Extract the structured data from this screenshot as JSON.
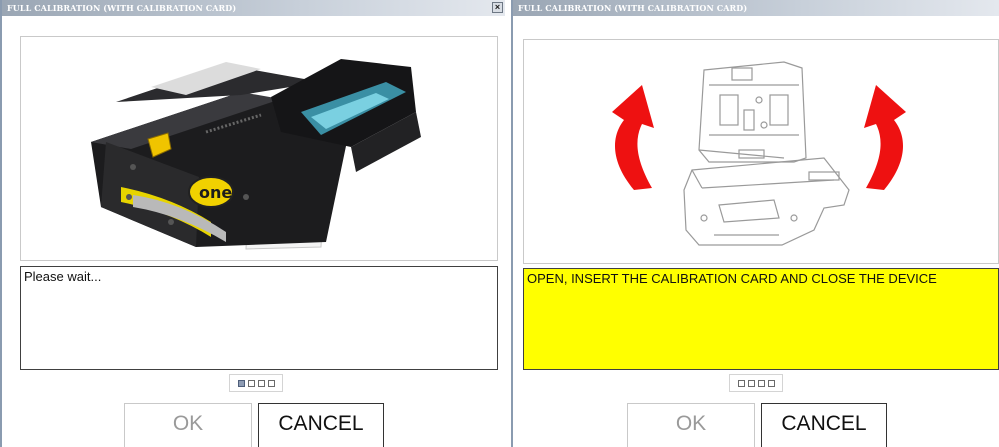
{
  "left_window": {
    "title": "FULL CALIBRATION (WITH CALIBRATION CARD)",
    "close_symbol": "×",
    "device_logo_text": "one",
    "message": "Please wait...",
    "progress": {
      "total_steps": 4,
      "active_step": 1
    },
    "buttons": {
      "ok": "OK",
      "cancel": "CANCEL"
    }
  },
  "right_window": {
    "title": "FULL CALIBRATION (WITH CALIBRATION CARD)",
    "message": "OPEN, INSERT THE CALIBRATION CARD AND CLOSE THE DEVICE",
    "message_background": "#ffff00",
    "arrow_color": "#ee1111",
    "progress": {
      "total_steps": 4,
      "active_step": 0
    },
    "buttons": {
      "ok": "OK",
      "cancel": "CANCEL"
    }
  }
}
